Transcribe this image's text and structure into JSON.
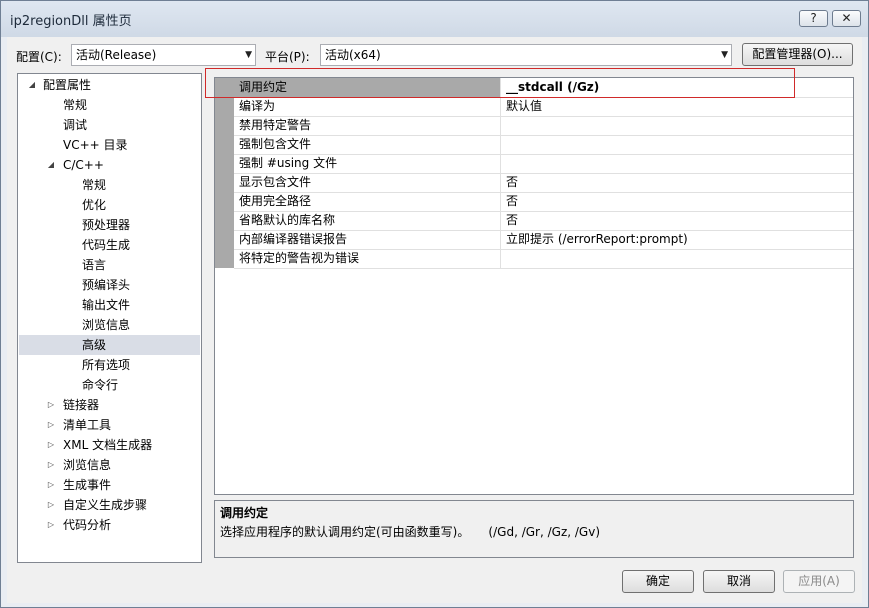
{
  "window": {
    "title": "ip2regionDll 属性页",
    "help_label": "?",
    "close_label": "✕"
  },
  "toolbar": {
    "config_label": "配置(C):",
    "config_value": "活动(Release)",
    "platform_label": "平台(P):",
    "platform_value": "活动(x64)",
    "config_manager_label": "配置管理器(O)..."
  },
  "tree": [
    {
      "label": "配置属性",
      "toggle": "◢",
      "selected": false
    },
    {
      "label": "常规",
      "toggle": "",
      "selected": false
    },
    {
      "label": "调试",
      "toggle": "",
      "selected": false
    },
    {
      "label": "VC++ 目录",
      "toggle": "",
      "selected": false
    },
    {
      "label": "C/C++",
      "toggle": "◢",
      "selected": false
    },
    {
      "label": "常规",
      "toggle": "",
      "selected": false
    },
    {
      "label": "优化",
      "toggle": "",
      "selected": false
    },
    {
      "label": "预处理器",
      "toggle": "",
      "selected": false
    },
    {
      "label": "代码生成",
      "toggle": "",
      "selected": false
    },
    {
      "label": "语言",
      "toggle": "",
      "selected": false
    },
    {
      "label": "预编译头",
      "toggle": "",
      "selected": false
    },
    {
      "label": "输出文件",
      "toggle": "",
      "selected": false
    },
    {
      "label": "浏览信息",
      "toggle": "",
      "selected": false
    },
    {
      "label": "高级",
      "toggle": "",
      "selected": true
    },
    {
      "label": "所有选项",
      "toggle": "",
      "selected": false
    },
    {
      "label": "命令行",
      "toggle": "",
      "selected": false
    },
    {
      "label": "链接器",
      "toggle": "▷",
      "selected": false
    },
    {
      "label": "清单工具",
      "toggle": "▷",
      "selected": false
    },
    {
      "label": "XML 文档生成器",
      "toggle": "▷",
      "selected": false
    },
    {
      "label": "浏览信息",
      "toggle": "▷",
      "selected": false
    },
    {
      "label": "生成事件",
      "toggle": "▷",
      "selected": false
    },
    {
      "label": "自定义生成步骤",
      "toggle": "▷",
      "selected": false
    },
    {
      "label": "代码分析",
      "toggle": "▷",
      "selected": false
    }
  ],
  "properties": [
    {
      "name": "调用约定",
      "value": "__stdcall (/Gz)",
      "selected": true
    },
    {
      "name": "编译为",
      "value": "默认值",
      "selected": false
    },
    {
      "name": "禁用特定警告",
      "value": "",
      "selected": false
    },
    {
      "name": "强制包含文件",
      "value": "",
      "selected": false
    },
    {
      "name": "强制 #using 文件",
      "value": "",
      "selected": false
    },
    {
      "name": "显示包含文件",
      "value": "否",
      "selected": false
    },
    {
      "name": "使用完全路径",
      "value": "否",
      "selected": false
    },
    {
      "name": "省略默认的库名称",
      "value": "否",
      "selected": false
    },
    {
      "name": "内部编译器错误报告",
      "value": "立即提示 (/errorReport:prompt)",
      "selected": false
    },
    {
      "name": "将特定的警告视为错误",
      "value": "",
      "selected": false
    }
  ],
  "description": {
    "title": "调用约定",
    "text": "选择应用程序的默认调用约定(可由函数重写)。     (/Gd, /Gr, /Gz, /Gv)"
  },
  "footer": {
    "ok_label": "确定",
    "cancel_label": "取消",
    "apply_label": "应用(A)"
  },
  "colors": {
    "selection_gray": "#a9a9a9",
    "highlight_box": "#d02a2a",
    "tree_selected": "#d9dde6"
  }
}
